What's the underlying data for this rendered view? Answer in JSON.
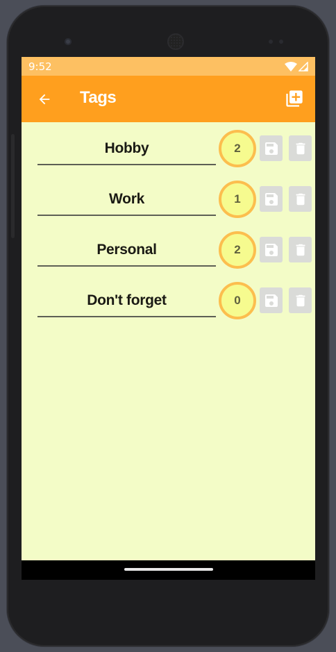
{
  "status_bar": {
    "time": "9:52"
  },
  "app_bar": {
    "title": "Tags",
    "back_icon": "arrow-back-icon",
    "add_icon": "library-add-icon"
  },
  "tags": [
    {
      "name": "Hobby",
      "count": "2"
    },
    {
      "name": "Work",
      "count": "1"
    },
    {
      "name": "Personal",
      "count": "2"
    },
    {
      "name": "Don't forget",
      "count": "0"
    }
  ],
  "colors": {
    "status_bar": "#fdc062",
    "app_bar": "#ff9f1e",
    "background": "#f3fcc7",
    "badge_fill": "#f6fb8f",
    "badge_ring": "#fcbe4e",
    "disabled_button": "#dadbd8"
  }
}
